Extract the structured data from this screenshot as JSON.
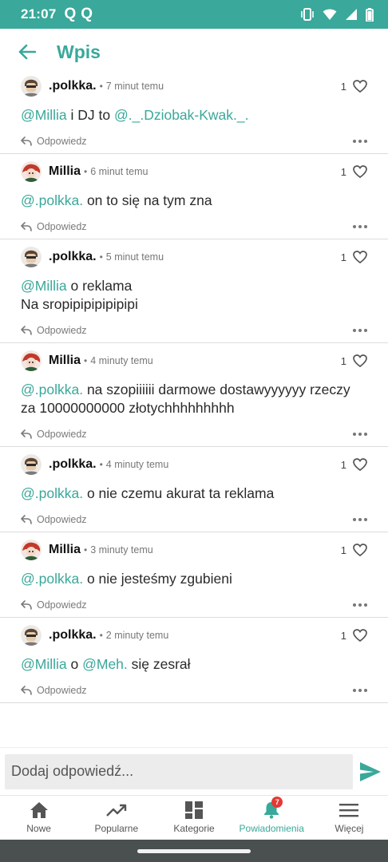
{
  "status_bar": {
    "time": "21:07",
    "notif_icons": [
      "Q",
      "Q"
    ],
    "icons": [
      "vibrate-icon",
      "wifi-icon",
      "signal-icon",
      "battery-icon"
    ]
  },
  "header": {
    "title": "Wpis",
    "back_icon": "arrow-left-icon"
  },
  "colors": {
    "accent": "#3aa89a",
    "status_bar": "#3aa89a",
    "badge": "#e53935"
  },
  "comments": [
    {
      "author": ".polkka.",
      "avatar": "polkka",
      "time": "7 minut temu",
      "likes": "1",
      "parts": [
        {
          "t": "@Millia",
          "m": true
        },
        {
          "t": " i DJ to ",
          "m": false
        },
        {
          "t": "@._.Dziobak-Kwak._.",
          "m": true
        }
      ]
    },
    {
      "author": "Millia",
      "avatar": "millia",
      "time": "6 minut temu",
      "likes": "1",
      "parts": [
        {
          "t": "@.polkka.",
          "m": true
        },
        {
          "t": " on to się na tym zna",
          "m": false
        }
      ]
    },
    {
      "author": ".polkka.",
      "avatar": "polkka",
      "time": "5 minut temu",
      "likes": "1",
      "parts": [
        {
          "t": "@Millia",
          "m": true
        },
        {
          "t": " o reklama\nNa sropipipipipipipi",
          "m": false
        }
      ]
    },
    {
      "author": "Millia",
      "avatar": "millia",
      "time": "4 minuty temu",
      "likes": "1",
      "parts": [
        {
          "t": "@.polkka.",
          "m": true
        },
        {
          "t": " na szopiiiiii darmowe dostawyyyyyy rzeczy za 10000000000 złotychhhhhhhhh",
          "m": false
        }
      ]
    },
    {
      "author": ".polkka.",
      "avatar": "polkka",
      "time": "4 minuty temu",
      "likes": "1",
      "parts": [
        {
          "t": "@.polkka.",
          "m": true
        },
        {
          "t": " o nie czemu akurat ta reklama",
          "m": false
        }
      ]
    },
    {
      "author": "Millia",
      "avatar": "millia",
      "time": "3 minuty temu",
      "likes": "1",
      "parts": [
        {
          "t": "@.polkka.",
          "m": true
        },
        {
          "t": " o nie jesteśmy zgubieni",
          "m": false
        }
      ]
    },
    {
      "author": ".polkka.",
      "avatar": "polkka",
      "time": "2 minuty temu",
      "likes": "1",
      "parts": [
        {
          "t": "@Millia",
          "m": true
        },
        {
          "t": " o ",
          "m": false
        },
        {
          "t": "@Meh.",
          "m": true
        },
        {
          "t": " się zesrał",
          "m": false
        }
      ]
    }
  ],
  "comment_labels": {
    "separator": "•",
    "reply": "Odpowiedz",
    "reply_icon": "reply-icon",
    "like_icon": "heart-outline-icon",
    "more_icon": "more-horizontal-icon"
  },
  "composer": {
    "placeholder": "Dodaj odpowiedź...",
    "value": "",
    "send_icon": "send-icon"
  },
  "bottom_nav": [
    {
      "label": "Nowe",
      "icon": "home-icon",
      "active": false
    },
    {
      "label": "Popularne",
      "icon": "trending-icon",
      "active": false
    },
    {
      "label": "Kategorie",
      "icon": "grid-icon",
      "active": false
    },
    {
      "label": "Powiadomienia",
      "icon": "bell-icon",
      "active": true,
      "badge": "7"
    },
    {
      "label": "Więcej",
      "icon": "menu-icon",
      "active": false
    }
  ]
}
